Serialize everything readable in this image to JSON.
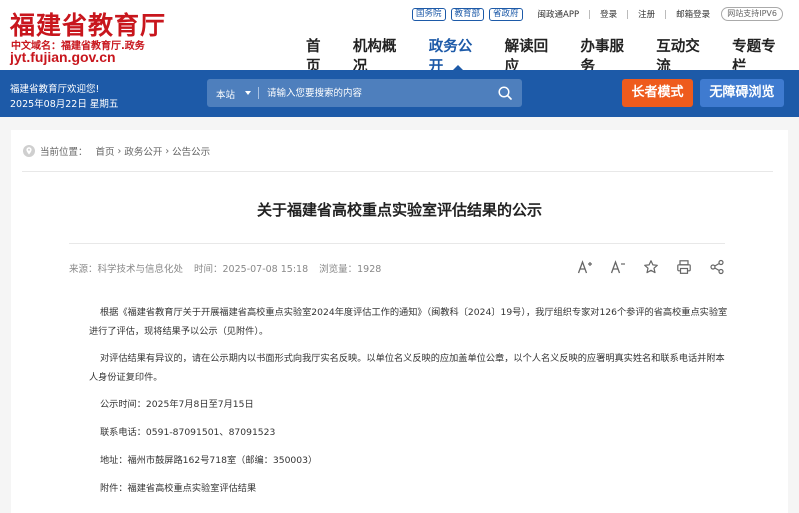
{
  "header": {
    "logo_title": "福建省教育厅",
    "logo_domain": "中文域名：福建省教育厅.政务",
    "logo_url": "jyt.fujian.gov.cn",
    "top_pills": [
      "国务院",
      "教育部",
      "省政府"
    ],
    "top_links": [
      "闽政通APP",
      "登录",
      "注册",
      "邮箱登录"
    ],
    "ipv6_badge": "网站支持IPV6",
    "nav": [
      "首页",
      "机构概况",
      "政务公开",
      "解读回应",
      "办事服务",
      "互动交流",
      "专题专栏"
    ],
    "active_nav": "政务公开"
  },
  "band": {
    "welcome": "福建省教育厅欢迎您!",
    "date": "2025年08月22日 星期五",
    "search_scope": "本站",
    "search_placeholder": "请输入您要搜索的内容",
    "elder_mode": "长者模式",
    "accessible": "无障碍浏览"
  },
  "breadcrumb": {
    "prefix": "当前位置：",
    "items": [
      "首页",
      "政务公开",
      "公告公示"
    ],
    "separator": "›"
  },
  "article": {
    "title": "关于福建省高校重点实验室评估结果的公示",
    "source": "来源：科学技术与信息化处",
    "time": "时间：2025-07-08 15:18",
    "views": "浏览量：1928",
    "paragraphs": [
      "根据《福建省教育厅关于开展福建省高校重点实验室2024年度评估工作的通知》（闽教科〔2024〕19号），我厅组织专家对126个参评的省高校重点实验室进行了评估，现将结果予以公示（见附件）。",
      "对评估结果有异议的，请在公示期内以书面形式向我厅实名反映。以单位名义反映的应加盖单位公章，以个人名义反映的应署明真实姓名和联系电话并附本人身份证复印件。"
    ],
    "lines": [
      "公示时间：2025年7月8日至7月15日",
      "联系电话：0591-87091501、87091523",
      "地址：福州市鼓屏路162号718室（邮编：350003）",
      "附件：福建省高校重点实验室评估结果"
    ]
  },
  "colors": {
    "brand_red": "#c8161d",
    "brand_blue": "#1d5aa8",
    "elder_orange": "#ee5b1d",
    "access_blue": "#3f7bd0"
  },
  "icons": [
    "location-icon",
    "search-icon",
    "font-increase-icon",
    "font-decrease-icon",
    "star-icon",
    "print-icon",
    "share-icon"
  ]
}
